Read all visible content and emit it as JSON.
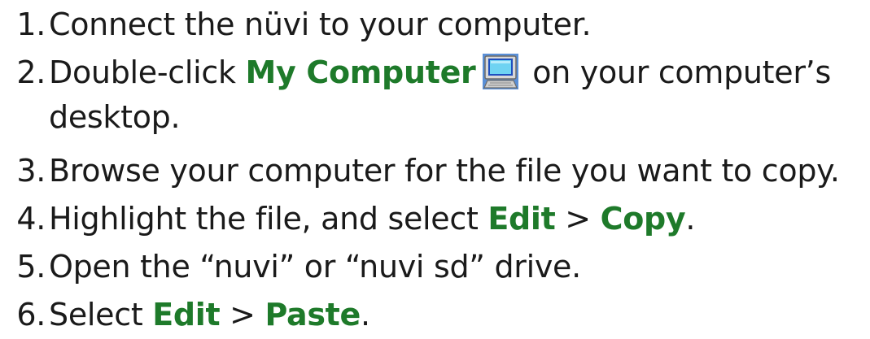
{
  "steps": [
    {
      "number": "1.",
      "text": "Connect the nüvi to your computer."
    },
    {
      "number": "2.",
      "before": "Double-click ",
      "highlight": "My Computer",
      "icon": "my-computer-icon",
      "after": " on your computer’s",
      "continuation": "desktop."
    },
    {
      "number": "3.",
      "text": "Browse your computer for the file you want to copy."
    },
    {
      "number": "4.",
      "before": "Highlight the file, and select ",
      "highlight1": "Edit",
      "separator": " > ",
      "highlight2": "Copy",
      "after": "."
    },
    {
      "number": "5.",
      "text": "Open the “nuvi” or “nuvi sd” drive."
    },
    {
      "number": "6.",
      "before": "Select ",
      "highlight1": "Edit",
      "separator": " > ",
      "highlight2": "Paste",
      "after": "."
    }
  ],
  "colors": {
    "highlight": "#1e7a2a",
    "text": "#1a1a1a"
  }
}
